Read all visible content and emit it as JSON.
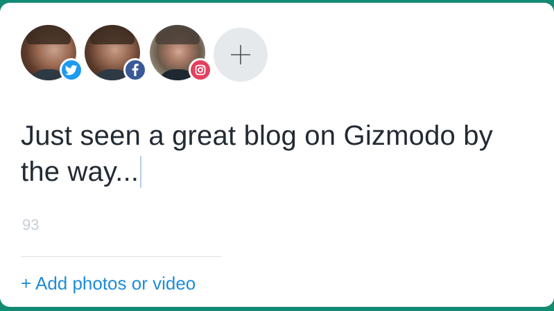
{
  "accounts": [
    {
      "network": "twitter",
      "icon": "twitter-icon",
      "color": "#1d9bf0"
    },
    {
      "network": "facebook",
      "icon": "facebook-icon",
      "color": "#3a5998"
    },
    {
      "network": "instagram",
      "icon": "instagram-icon",
      "color": "#e4405f"
    }
  ],
  "add_account": {
    "icon": "plus-icon"
  },
  "composer": {
    "text_line1": "Just seen a great blog on Gizmodo by",
    "text_line2": "the way..."
  },
  "char_count": "93",
  "add_media_label": "+ Add photos or video",
  "colors": {
    "frame": "#138a72",
    "link": "#1e8cd8",
    "text": "#222a33",
    "muted": "#c7ced6"
  }
}
